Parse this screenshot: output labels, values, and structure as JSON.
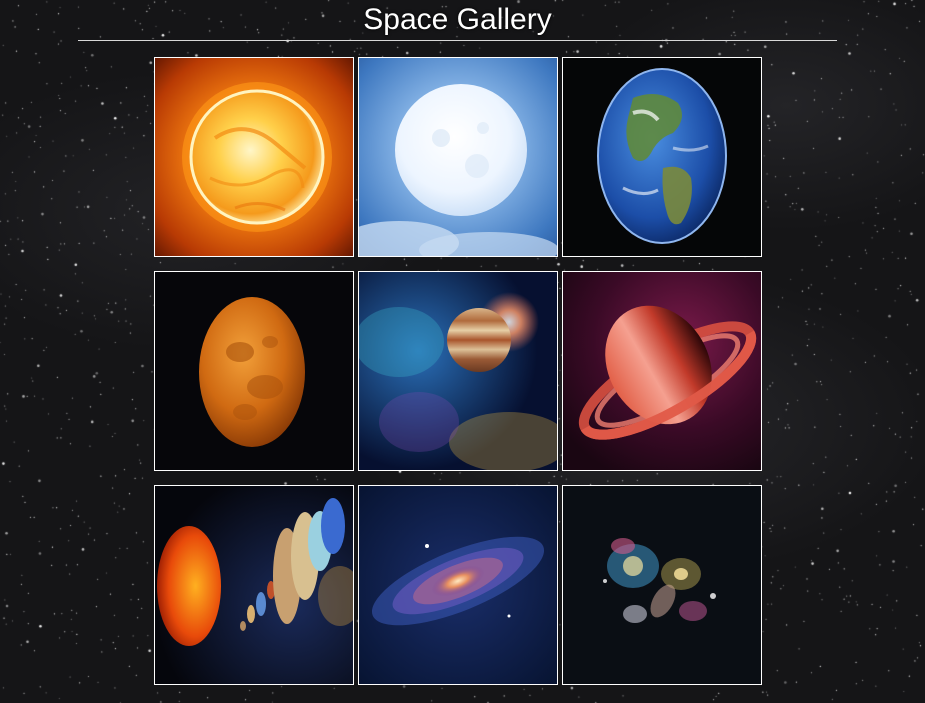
{
  "page": {
    "title": "Space Gallery",
    "background_color": "#151517",
    "text_color": "#ffffff",
    "border_color": "#ffffff"
  },
  "gallery": {
    "images": [
      {
        "subject": "sun",
        "icon": "sun-image"
      },
      {
        "subject": "full-moon",
        "icon": "moon-image"
      },
      {
        "subject": "earth",
        "icon": "earth-image"
      },
      {
        "subject": "mars",
        "icon": "mars-image"
      },
      {
        "subject": "jupiter-nebula",
        "icon": "jupiter-image"
      },
      {
        "subject": "saturn",
        "icon": "saturn-image"
      },
      {
        "subject": "solar-system",
        "icon": "solar-system-image"
      },
      {
        "subject": "spiral-galaxy",
        "icon": "galaxy-image"
      },
      {
        "subject": "colliding-galaxies",
        "icon": "galaxies-image"
      }
    ]
  }
}
